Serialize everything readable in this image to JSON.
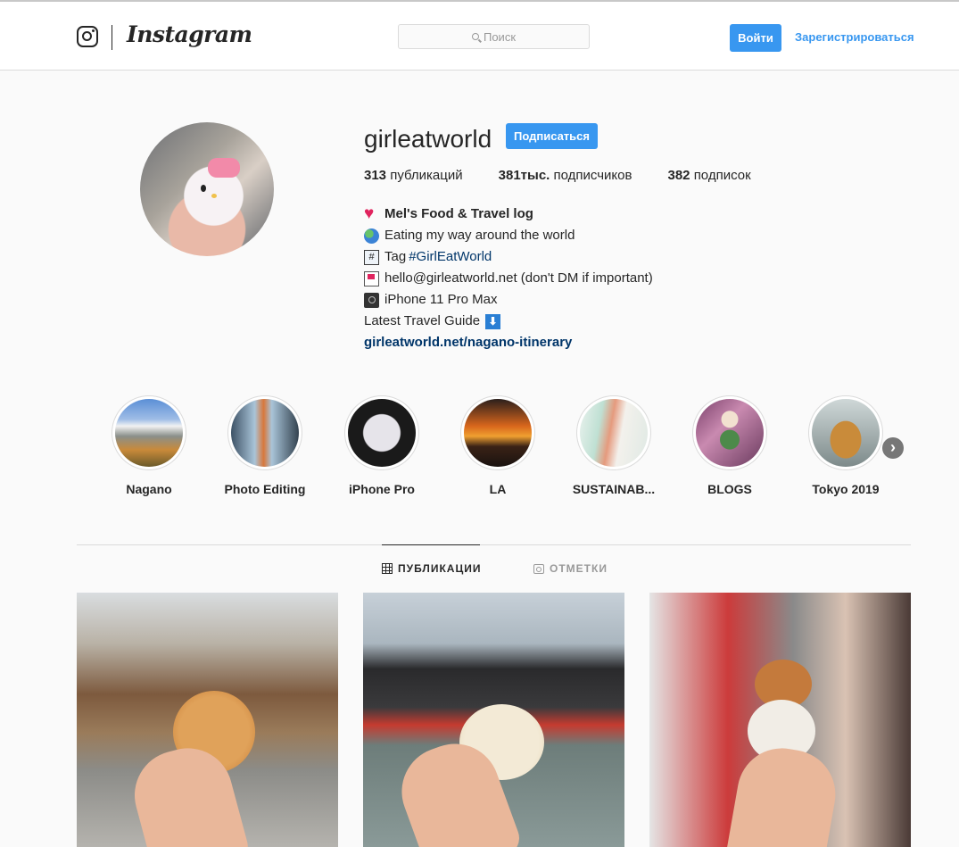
{
  "header": {
    "brand": "Instagram",
    "search_placeholder": "Поиск",
    "login_label": "Войти",
    "signup_label": "Зарегистрироваться"
  },
  "profile": {
    "username": "girleatworld",
    "follow_label": "Подписаться",
    "stats": [
      {
        "count": "313",
        "label": "публикаций"
      },
      {
        "count": "381тыс.",
        "label": "подписчиков"
      },
      {
        "count": "382",
        "label": "подписок"
      }
    ],
    "bio": {
      "name": "Mel's Food & Travel log",
      "line1": "Eating my way around the world",
      "line2_prefix": "Tag",
      "line2_tag": "#GirlEatWorld",
      "line3": "hello@girleatworld.net (don't DM if important)",
      "line4": "iPhone 11 Pro Max",
      "line5": "Latest Travel Guide",
      "link": "girleatworld.net/nagano-itinerary"
    }
  },
  "highlights": [
    {
      "label": "Nagano"
    },
    {
      "label": "Photo Editing"
    },
    {
      "label": "iPhone Pro"
    },
    {
      "label": "LA"
    },
    {
      "label": "SUSTAINAB..."
    },
    {
      "label": "BLOGS"
    },
    {
      "label": "Tokyo 2019"
    }
  ],
  "tabs": {
    "posts": "ПУБЛИКАЦИИ",
    "tagged": "ОТМЕТКИ"
  },
  "colors": {
    "accent": "#3897f0",
    "link": "#003569",
    "text": "#262626",
    "background": "#fafafa"
  }
}
